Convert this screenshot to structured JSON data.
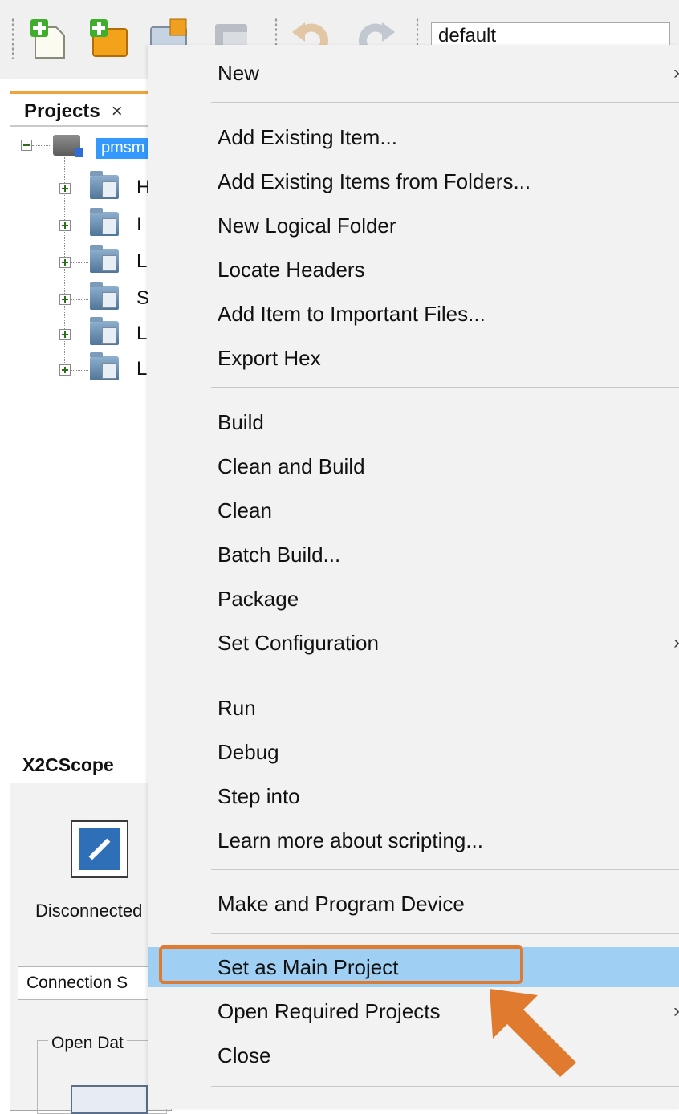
{
  "toolbar": {
    "configuration_value": "default"
  },
  "projects": {
    "tab_label": "Projects",
    "tab_close": "×",
    "root_label": "pmsm",
    "items": [
      {
        "label": "H"
      },
      {
        "label": "I"
      },
      {
        "label": "L"
      },
      {
        "label": "S"
      },
      {
        "label": "L"
      },
      {
        "label": "L"
      }
    ]
  },
  "x2cscope": {
    "tab_label": "X2CScope",
    "status_label": "Disconnected",
    "connection_tab": "Connection S",
    "group_label": "Open Dat"
  },
  "context_menu": {
    "items": [
      {
        "label": "New",
        "submenu": true
      },
      {
        "label": "Add Existing Item..."
      },
      {
        "label": "Add Existing Items from Folders..."
      },
      {
        "label": "New Logical Folder"
      },
      {
        "label": "Locate Headers"
      },
      {
        "label": "Add Item to Important Files..."
      },
      {
        "label": "Export Hex"
      },
      {
        "label": "Build"
      },
      {
        "label": "Clean and Build"
      },
      {
        "label": "Clean"
      },
      {
        "label": "Batch Build..."
      },
      {
        "label": "Package"
      },
      {
        "label": "Set Configuration",
        "submenu": true
      },
      {
        "label": "Run"
      },
      {
        "label": "Debug"
      },
      {
        "label": "Step into"
      },
      {
        "label": "Learn more about scripting..."
      },
      {
        "label": "Make and Program Device"
      },
      {
        "label": "Set as Main Project",
        "selected": true
      },
      {
        "label": "Open Required Projects",
        "submenu": true
      },
      {
        "label": "Close"
      }
    ],
    "submenu_arrow": "›"
  },
  "colors": {
    "selection": "#9fcff3",
    "callout": "#e07a2f",
    "tree_selection": "#3399ff"
  }
}
